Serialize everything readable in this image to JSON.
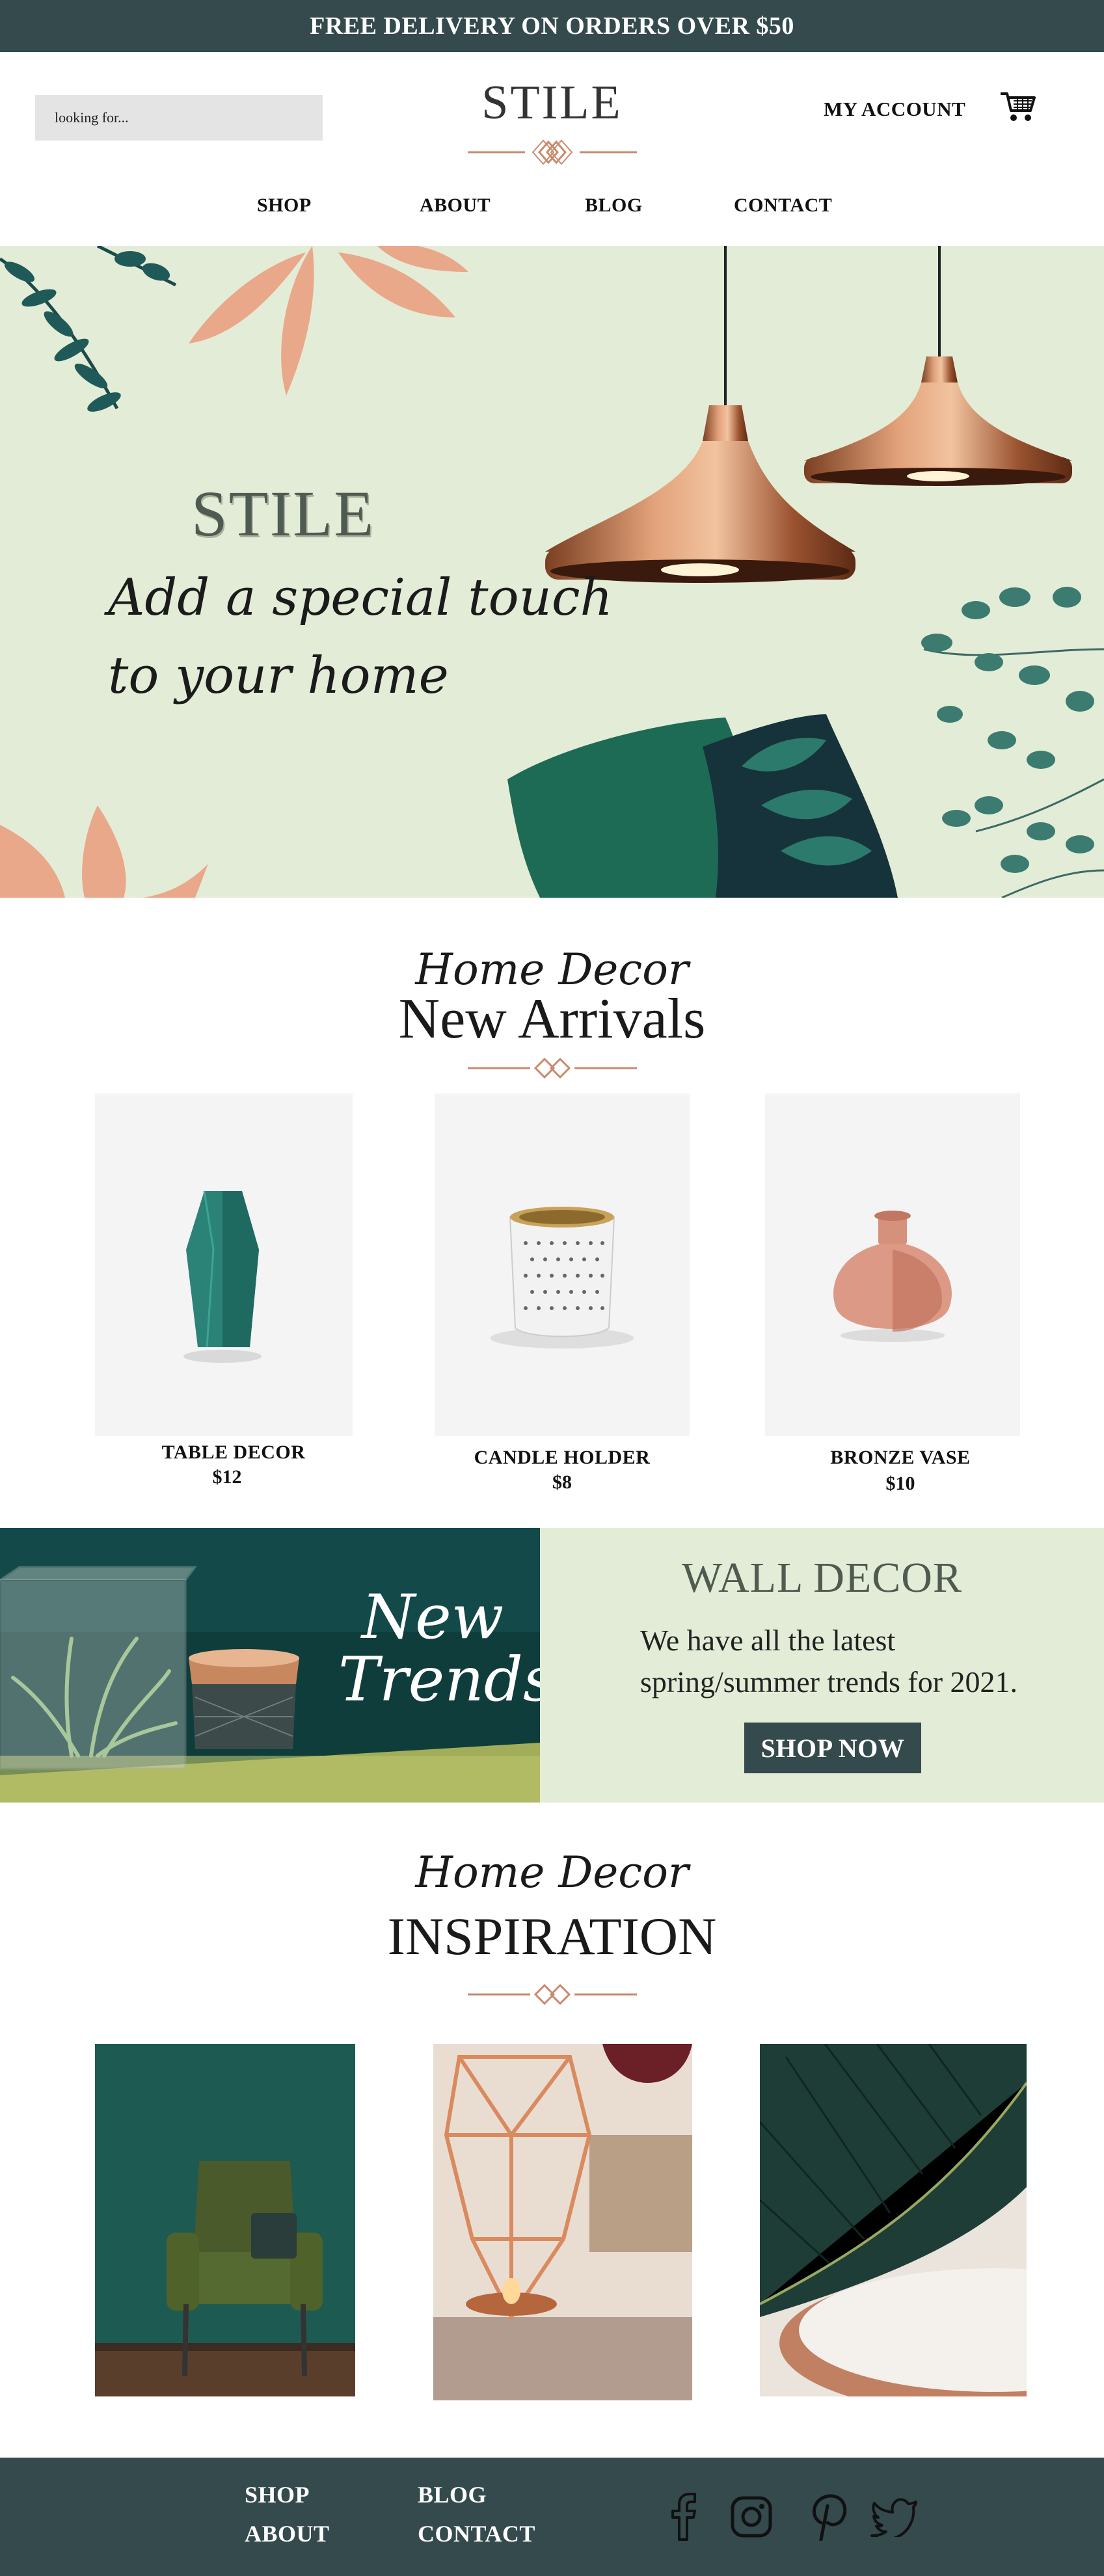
{
  "promo": {
    "text": "FREE DELIVERY ON ORDERS OVER $50"
  },
  "header": {
    "search_placeholder": "looking for...",
    "logo": "STILE",
    "account_label": "MY ACCOUNT",
    "cart_icon": "cart-icon"
  },
  "nav": {
    "items": [
      {
        "label": "SHOP"
      },
      {
        "label": "ABOUT"
      },
      {
        "label": "BLOG"
      },
      {
        "label": "CONTACT"
      }
    ]
  },
  "hero": {
    "title": "STILE",
    "tagline_line1": "Add a special touch",
    "tagline_line2": "to your home"
  },
  "new_arrivals": {
    "script": "Home Decor",
    "heading": "New Arrivals",
    "products": [
      {
        "name": "TABLE DECOR",
        "price": "$12"
      },
      {
        "name": "CANDLE HOLDER",
        "price": "$8"
      },
      {
        "name": "BRONZE VASE",
        "price": "$10"
      }
    ]
  },
  "wall_decor": {
    "overlay_line1": "New",
    "overlay_line2": "Trends",
    "title": "WALL DECOR",
    "text_line1": "We have all the latest",
    "text_line2": "spring/summer trends for 2021.",
    "button": "SHOP NOW"
  },
  "inspiration": {
    "script": "Home Decor",
    "heading": "INSPIRATION"
  },
  "footer": {
    "links": [
      {
        "label": "SHOP"
      },
      {
        "label": "BLOG"
      },
      {
        "label": "ABOUT"
      },
      {
        "label": "CONTACT"
      }
    ],
    "social": [
      "facebook-icon",
      "instagram-icon",
      "pinterest-icon",
      "twitter-icon"
    ]
  },
  "colors": {
    "dark_teal": "#344a4d",
    "sage": "#e3ecd7",
    "copper": "#c98a6d",
    "deep_green": "#0f3d3c"
  }
}
